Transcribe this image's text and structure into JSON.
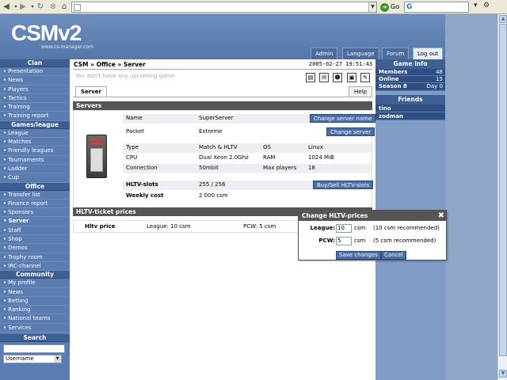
{
  "browser": {
    "back_icon": "arrow-left-icon",
    "address_value": "",
    "go_label": "Go",
    "search_value": ""
  },
  "header": {
    "logo": "CSMv2",
    "logo_sub": "www.cs-manager.com",
    "nav": [
      "Admin",
      "Language",
      "Forum",
      "Log out"
    ]
  },
  "leftnav": {
    "sections": [
      {
        "title": "Clan",
        "items": [
          "Presentation",
          "News",
          "Players",
          "Tactics",
          "Training",
          "Training report"
        ]
      },
      {
        "title": "Games/league",
        "items": [
          "League",
          "Matches",
          "Friendly leagues",
          "Tournaments",
          "Ladder",
          "Cup"
        ]
      },
      {
        "title": "Office",
        "items": [
          "Transfer list",
          "Finance report",
          "Sponsors",
          "Server",
          "Staff",
          "Shop",
          "Demos",
          "Trophy room",
          "IRC-channel"
        ]
      },
      {
        "title": "Community",
        "items": [
          "My profile",
          "News",
          "Betting",
          "Ranking",
          "National teams",
          "Services"
        ]
      }
    ],
    "active_item": "Server",
    "search_title": "Search",
    "search_value": "",
    "search_select": "Username"
  },
  "main": {
    "breadcrumb": "CSM » Office » Server",
    "datetime": "2005-02-27 19:51:43",
    "no_game": "You don't have any upcoming game",
    "tabs": [
      "Server",
      "Help"
    ],
    "servers_title": "Servers",
    "name_label": "Name",
    "name_value": "SuperServer",
    "change_name_btn": "Change server name",
    "packet_label": "Packet",
    "packet_value": "Extreme",
    "change_server_btn": "Change server",
    "type_label": "Type",
    "type_value": "Match & HLTV",
    "os_label": "OS",
    "os_value": "Linux",
    "cpu_label": "CPU",
    "cpu_value": "Dual Xeon 2.0Ghz",
    "ram_label": "RAM",
    "ram_value": "1024 MiB",
    "conn_label": "Connection",
    "conn_value": "50mbit",
    "maxp_label": "Max players",
    "maxp_value": "18",
    "hltv_label": "HLTV-slots",
    "hltv_value": "255 / 256",
    "buy_sell_btn": "Buy/Sell HLTV-slots",
    "weekly_label": "Weekly cost",
    "weekly_value": "2 000 csm",
    "prices_title": "HLTV-ticket prices",
    "hltv_price_label": "Hltv price",
    "league_price": "League: 10 csm",
    "pcw_price": "PCW: 5 csm"
  },
  "right": {
    "gameinfo_title": "Game info",
    "stats": [
      {
        "label": "Members",
        "value": "48"
      },
      {
        "label": "Online",
        "value": "15"
      },
      {
        "label": "Season 8",
        "value": "Day 0"
      }
    ],
    "friends_title": "Friends",
    "friends": [
      "tino",
      "zodman"
    ]
  },
  "dialog": {
    "title": "Change HLTV-prices",
    "league_label": "League:",
    "league_value": "10",
    "league_unit": "csm",
    "league_note": "(10 csm recommended)",
    "pcw_label": "PCW:",
    "pcw_value": "5",
    "pcw_unit": "csm",
    "pcw_note": "(5 csm recommended)",
    "save_btn": "Save changes",
    "cancel_btn": "Cancel"
  }
}
